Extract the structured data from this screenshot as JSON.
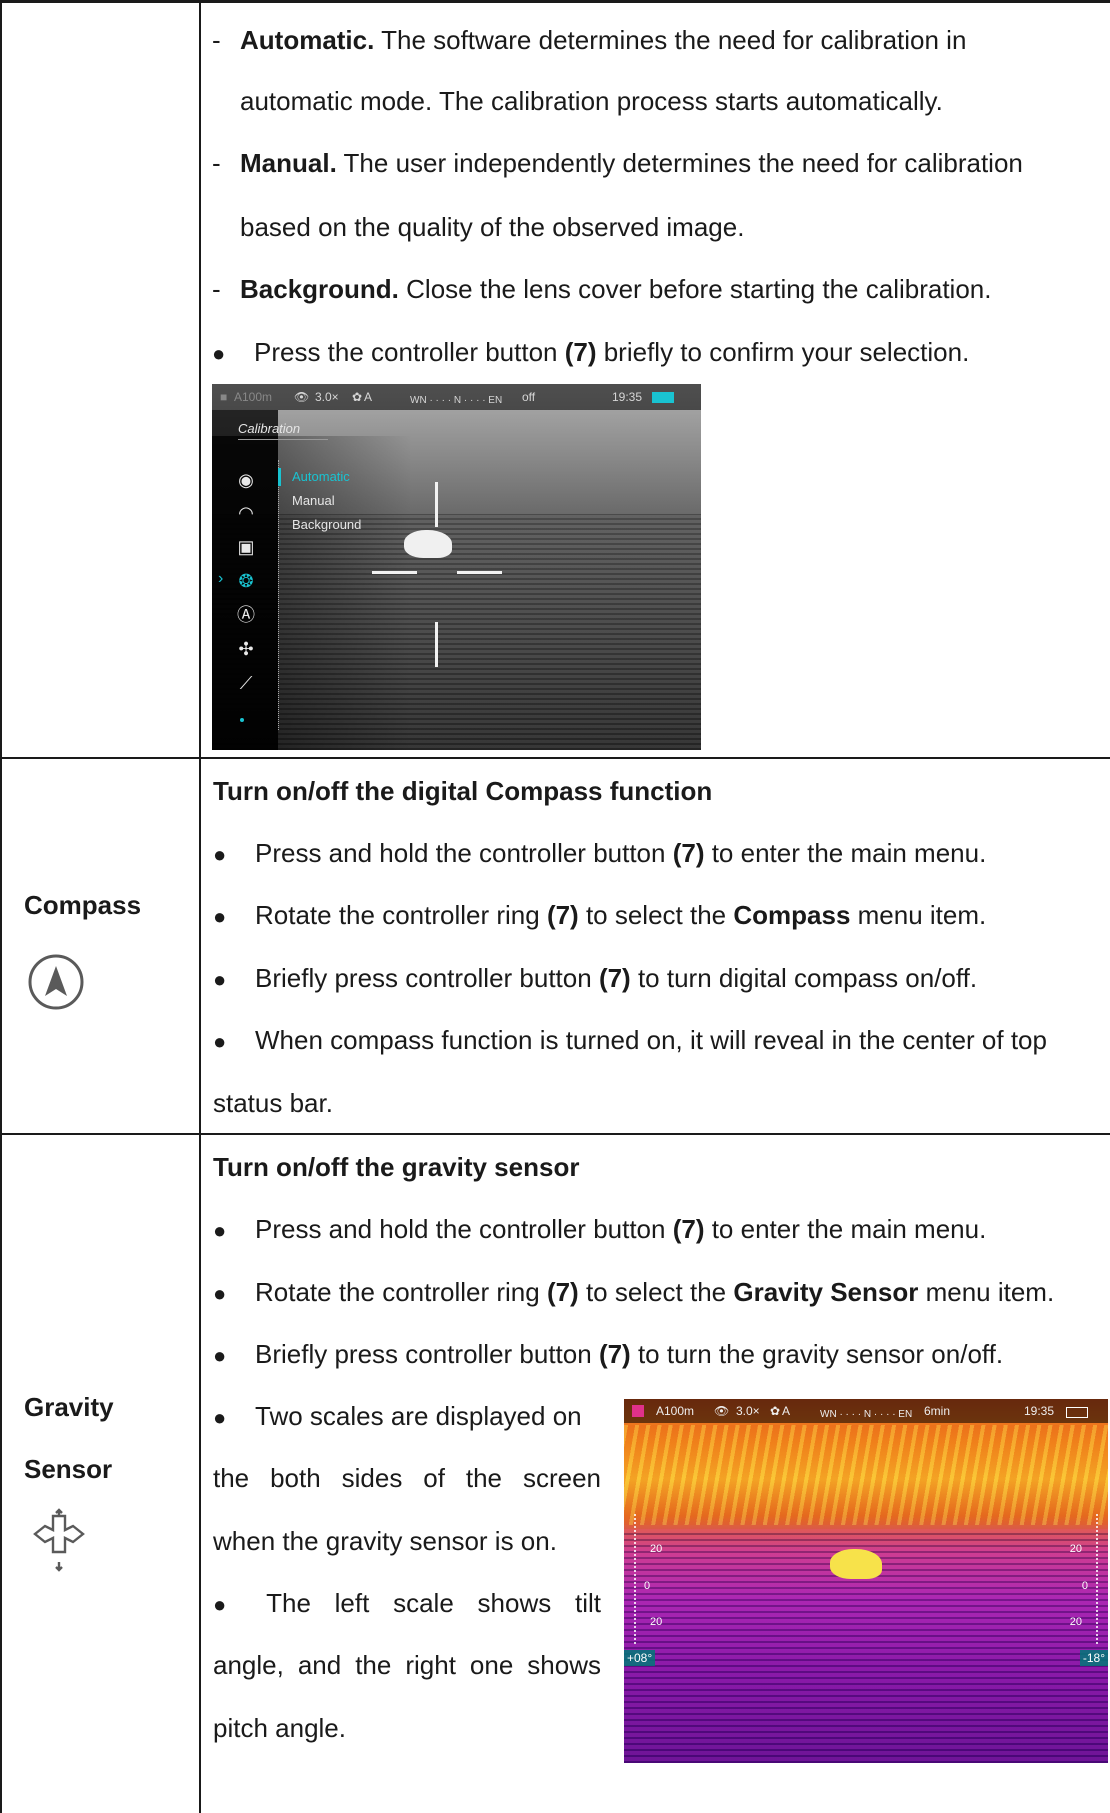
{
  "row1": {
    "items": [
      {
        "marker": "-",
        "bold": "Automatic.",
        "text": " The software determines the need for calibration in",
        "cont": "automatic mode. The calibration process starts automatically."
      },
      {
        "marker": "-",
        "bold": "Manual.",
        "text": " The user independently determines the need for calibration",
        "cont": "based on the quality of the observed image."
      },
      {
        "marker": "-",
        "bold": "Background.",
        "text": " Close the lens cover before starting the calibration."
      }
    ],
    "confirm": {
      "pre": "Press the controller button ",
      "num": "(7)",
      "post": " briefly to confirm your selection."
    },
    "screen": {
      "status_left": "A100m",
      "zoom": "3.0×",
      "mode": "A",
      "compass": "WN · · · · N · · · · EN",
      "status_right": "off",
      "time": "19:35",
      "menu_title": "Calibration",
      "options": [
        "Automatic",
        "Manual",
        "Background"
      ],
      "accent": "#19c3d1"
    }
  },
  "row2": {
    "label": "Compass",
    "icon": "compass-icon",
    "heading": "Turn on/off the digital Compass function",
    "b1": {
      "pre": "Press and hold the controller button ",
      "num": "(7)",
      "post": " to enter the main menu."
    },
    "b2": {
      "pre": "Rotate the controller ring ",
      "num": "(7)",
      "mid": " to select the ",
      "bold": "Compass",
      "post": " menu item."
    },
    "b3": {
      "pre": "Briefly press controller button ",
      "num": "(7)",
      "post": " to turn digital compass on/off."
    },
    "b4": {
      "text": "When compass function is turned on, it will reveal in the center of top",
      "cont": "status bar."
    }
  },
  "row3": {
    "label1": "Gravity",
    "label2": "Sensor",
    "icon": "gravity-sensor-icon",
    "heading": "Turn on/off the gravity sensor",
    "b1": {
      "pre": "Press and hold the controller button ",
      "num": "(7)",
      "post": " to enter the main menu."
    },
    "b2": {
      "pre": "Rotate the controller ring ",
      "num": "(7)",
      "mid": " to select the ",
      "bold": "Gravity Sensor",
      "post": " menu item."
    },
    "b3": {
      "pre": "Briefly press controller button ",
      "num": "(7)",
      "post": " to turn the gravity sensor on/off."
    },
    "b4": [
      "Two scales are displayed on",
      "the both sides of the screen",
      "when the gravity sensor is on."
    ],
    "b5": [
      "The left scale shows tilt",
      "angle, and the right one shows",
      "pitch angle."
    ],
    "screen": {
      "status_left": "A100m",
      "zoom": "3.0×",
      "mode": "A",
      "compass": "WN · · · · N · · · · EN",
      "timer": "6min",
      "time": "19:35",
      "scale_top": "20",
      "scale_mid": "0",
      "scale_bot": "20",
      "left_angle": "+08°",
      "right_angle": "-18°"
    }
  }
}
